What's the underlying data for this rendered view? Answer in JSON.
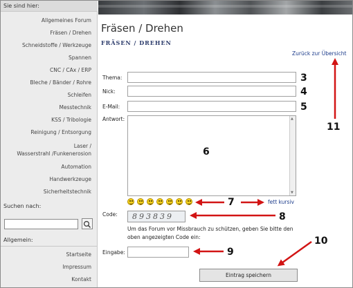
{
  "sidebar": {
    "breadcrumb_label": "Sie sind hier:",
    "forum_items": [
      "Allgemeines Forum",
      "Fräsen / Drehen",
      "Schneidstoffe / Werkzeuge",
      "Spannen",
      "CNC / CAx / ERP",
      "Bleche / Bänder / Rohre",
      "Schleifen",
      "Messtechnik",
      "KSS / Tribologie",
      "Reinigung / Entsorgung",
      "Laser /",
      "Wasserstrahl /Funkenerosion",
      "Automation",
      "Handwerkzeuge",
      "Sicherheitstechnik"
    ],
    "search_label": "Suchen nach:",
    "search_value": "",
    "general_label": "Allgemein:",
    "general_items": [
      "Startseite",
      "Impressum",
      "Kontakt"
    ]
  },
  "main": {
    "title": "Fräsen / Drehen",
    "subtitle": "FRÄSEN / DREHEN",
    "back_link": "Zurück zur Übersicht",
    "form": {
      "topic_label": "Thema:",
      "nick_label": "Nick:",
      "email_label": "E-Mail:",
      "answer_label": "Antwort:",
      "code_label": "Code:",
      "format_links": "fett kursiv",
      "captcha_code": "893839",
      "captcha_hint": "Um das Forum vor Missbrauch zu schützen, geben Sie bitte den oben angezeigten Code ein:",
      "input_label": "Eingabe:",
      "submit_label": "Eintrag speichern"
    }
  },
  "annotations": [
    "3",
    "4",
    "5",
    "6",
    "7",
    "8",
    "9",
    "10",
    "11"
  ],
  "colors": {
    "link": "#1a3a8a",
    "arrow": "#d21414",
    "sidebar_bg": "#ececec",
    "smiley": "#f4d21c"
  }
}
